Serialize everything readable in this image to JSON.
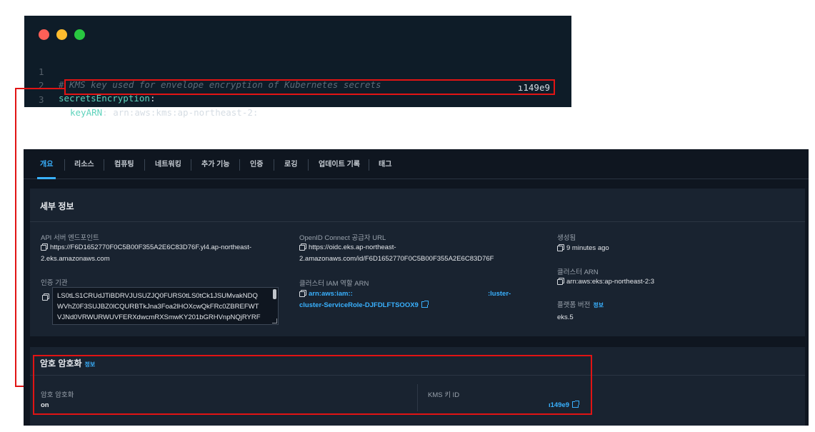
{
  "code": {
    "colors": {
      "bg": "#0e1c28",
      "comment": "#5d6b78",
      "key": "#5fd3bc",
      "value": "#d6dde4",
      "highlight": "#e11414"
    },
    "window_dots": [
      "#ff5f57",
      "#febc2e",
      "#28c840"
    ],
    "lines": [
      {
        "num": "1",
        "comment": "# KMS key used for envelope encryption of Kubernetes secrets"
      },
      {
        "num": "2",
        "key": "secretsEncryption",
        "sep": ":"
      },
      {
        "num": "3",
        "key": "keyARN",
        "sep": ":",
        "value": " arn:aws:kms:ap-northeast-2:",
        "value_tail": "ı149e9"
      }
    ]
  },
  "console": {
    "tabs": [
      "개요",
      "리소스",
      "컴퓨팅",
      "네트워킹",
      "추가 기능",
      "인증",
      "로깅",
      "업데이트 기록",
      "태그"
    ],
    "active_tab": "개요",
    "details": {
      "title": "세부 정보",
      "api_endpoint_label": "API 서버 엔드포인트",
      "api_endpoint_line1": "https://F6D1652770F0C5B00F355A2E6C83D76F.yl4.ap-northeast-",
      "api_endpoint_line2": "2.eks.amazonaws.com",
      "cert_authority_label": "인증 기관",
      "cert_lines": [
        "LS0tLS1CRUdJTiBDRVJUSUZJQ0FURS0tLS0tCk1JSUMvakNDQ",
        "WVhZ0F3SUJBZ0lCQURBTkJna3Foa2lHOXcwQkFRc0ZBREFWT",
        "VJNd0VRWURWUVFERXdwcmRXSmwKY201bGRHVnpNQjRYRF"
      ],
      "oidc_label": "OpenID Connect 공급자 URL",
      "oidc_line1": "https://oidc.eks.ap-northeast-",
      "oidc_line2": "2.amazonaws.com/id/F6D1652770F0C5B00F355A2E6C83D76F",
      "iam_role_label": "클러스터 IAM 역할 ARN",
      "iam_role_part1": "arn:aws:iam::",
      "iam_role_part2": ":luster-",
      "iam_role_line2": "cluster-ServiceRole-DJFDLFTSOOX9",
      "created_label": "생성됨",
      "created_value": "9 minutes ago",
      "cluster_arn_label": "클러스터 ARN",
      "cluster_arn_value": "arn:aws:eks:ap-northeast-2:3",
      "platform_version_label": "플랫폼 버전",
      "platform_version_info": "정보",
      "platform_version_value": "eks.5"
    },
    "encryption": {
      "title": "암호 암호화",
      "info": "정보",
      "status_label": "암호 암호화",
      "status_value": "on",
      "kms_label": "KMS 키 ID",
      "kms_value": "ı149e9"
    },
    "colors": {
      "bg": "#0f1620",
      "panel": "#192330",
      "link": "#39b1ff",
      "text": "#e3e6ea",
      "muted": "#9aa3ad"
    }
  }
}
